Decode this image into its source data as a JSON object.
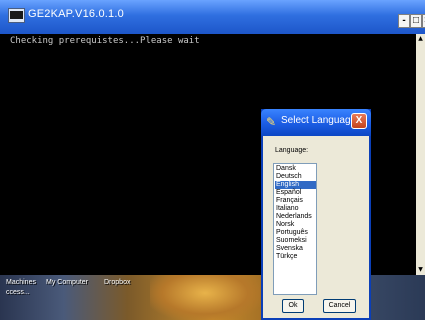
{
  "console": {
    "title": "GE2KAP.V16.0.1.0",
    "output": "Checking prerequistes...Please wait",
    "minimize": "-",
    "maximize": "□",
    "close": "×"
  },
  "desktop": {
    "icons": [
      "Machines",
      "My Computer",
      "Dropbox"
    ],
    "second_line": "ccess..."
  },
  "dialog": {
    "title": "Select Language",
    "close": "X",
    "language_label": "Language:",
    "languages": [
      "Dansk",
      "Deutsch",
      "English",
      "Español",
      "Français",
      "Italiano",
      "Nederlands",
      "Norsk",
      "Português",
      "Suomeksi",
      "Svenska",
      "Türkçe"
    ],
    "selected": "English",
    "ok_label": "Ok",
    "cancel_label": "Cancel"
  },
  "colors": {
    "titlebar": "#2f6fe0",
    "selection": "#316ac5",
    "dialog_bg": "#ece9d8"
  }
}
